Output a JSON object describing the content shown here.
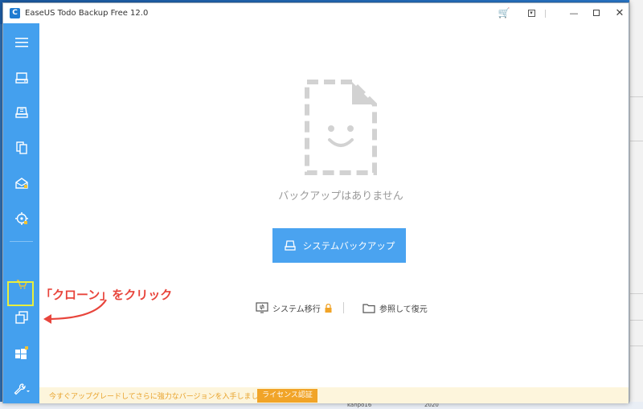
{
  "window": {
    "title": "EaseUS Todo Backup Free 12.0"
  },
  "main": {
    "empty_message": "バックアップはありません",
    "system_backup_label": "システムバックアップ",
    "system_migration_label": "システム移行",
    "browse_restore_label": "参照して復元"
  },
  "promo": {
    "text": "今すぐアップグレードしてさらに強力なバージョンを入手しましょう。",
    "license_label": "ライセンス認証"
  },
  "annotation": {
    "text": "「クローン」をクリック"
  },
  "background": {
    "taskbar_item": "kanpo16",
    "taskbar_year": "2020"
  },
  "colors": {
    "sidebar": "#44a0ee",
    "primary_button": "#4aa3f0",
    "annotation": "#e8453c",
    "highlight": "#e9ef3c",
    "promo_bg": "#fdf5dc",
    "promo_button": "#f1a428"
  }
}
